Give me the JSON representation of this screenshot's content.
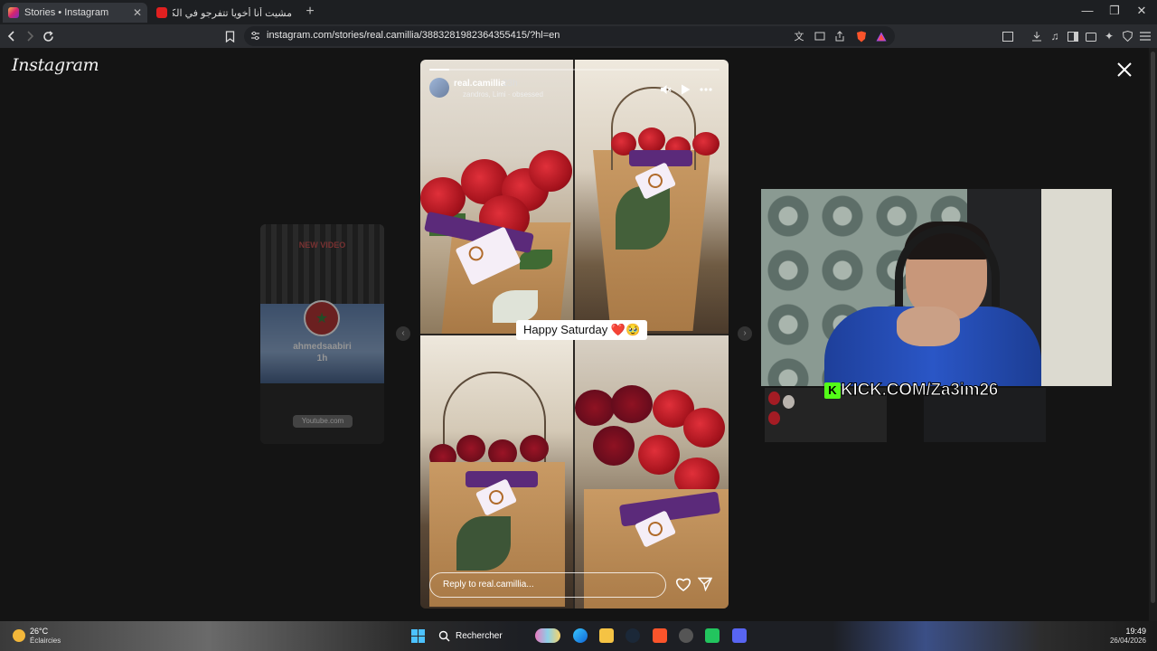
{
  "tabs": [
    {
      "title": "Stories • Instagram",
      "active": true
    },
    {
      "title": "مشيت أنا أخويا تتفرجو في الكوكوب 😡",
      "active": false
    }
  ],
  "toolbar": {
    "url": "instagram.com/stories/real.camillia/3883281982364355415/?hl=en"
  },
  "instagram": {
    "logo": "Instagram",
    "story": {
      "username": "real.camillia",
      "time": "23h",
      "music": "zandros, Limi · obsessed",
      "caption": "Happy Saturday ❤️🥹",
      "progress_fraction": 0.07,
      "reply_placeholder": "Reply to real.camillia..."
    },
    "preview": {
      "banner": "NEW VIDEO",
      "username": "ahmedsaabiri",
      "time": "1h",
      "source": "Youtube.com"
    }
  },
  "webcam": {
    "overlay": "KICK.COM/Za3im26",
    "logo_letter": "K"
  },
  "taskbar": {
    "weather_temp": "26°C",
    "weather_desc": "Éclaircies",
    "search_label": "Rechercher",
    "time": "19:49",
    "date": "26/04/2026"
  },
  "colors": {
    "instagram_bg": "#141414",
    "kick_green": "#53fc18",
    "browser_chrome": "#1d1f22"
  }
}
